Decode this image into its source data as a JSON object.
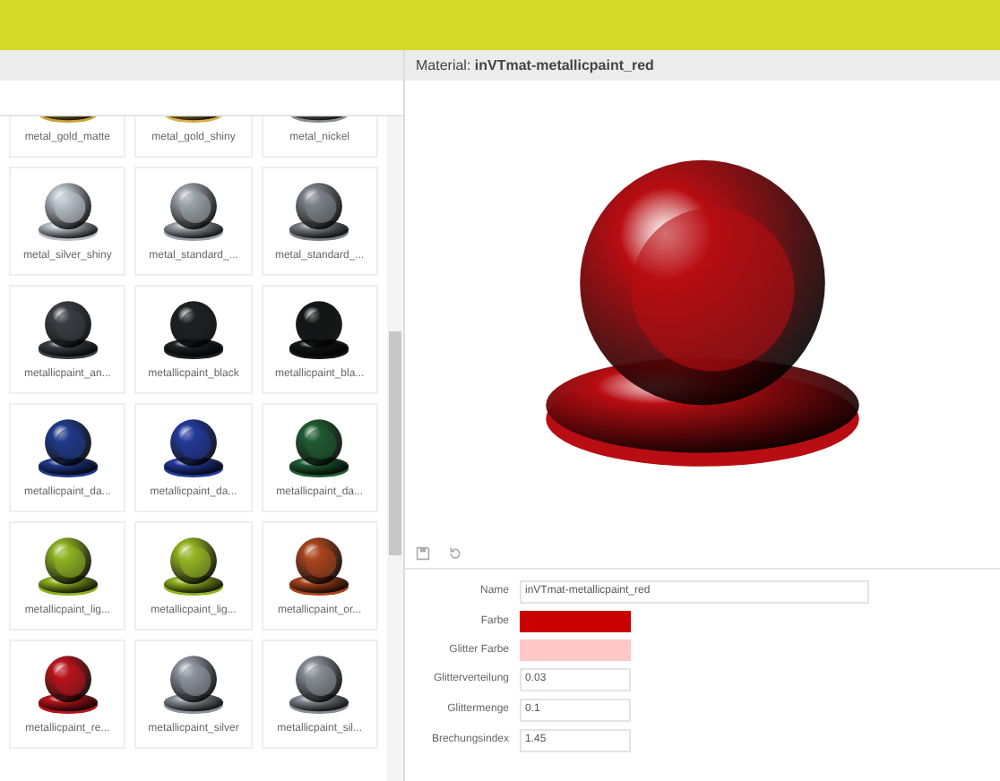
{
  "header": {
    "text": "Material: **inVTmat-metallicpaint_red**"
  },
  "materials": [
    {
      "label": "metal_gold_matte",
      "color": "#c9a23a"
    },
    {
      "label": "metal_gold_shiny",
      "color": "#d8b04a"
    },
    {
      "label": "metal_nickel",
      "color": "#8a8d92"
    },
    {
      "label": "metal_silver_shiny",
      "color": "#b8c0c8"
    },
    {
      "label": "metal_standard_...",
      "color": "#9aa0a8"
    },
    {
      "label": "metal_standard_...",
      "color": "#7c8088"
    },
    {
      "label": "metallicpaint_an...",
      "color": "#3a3d42"
    },
    {
      "label": "metallicpaint_black",
      "color": "#1e2022"
    },
    {
      "label": "metallicpaint_bla...",
      "color": "#141516"
    },
    {
      "label": "metallicpaint_da...",
      "color": "#1f3a8a"
    },
    {
      "label": "metallicpaint_da...",
      "color": "#22399a"
    },
    {
      "label": "metallicpaint_da...",
      "color": "#1f5a32"
    },
    {
      "label": "metallicpaint_lig...",
      "color": "#8db020"
    },
    {
      "label": "metallicpaint_lig...",
      "color": "#93b422"
    },
    {
      "label": "metallicpaint_or...",
      "color": "#a8441c"
    },
    {
      "label": "metallicpaint_re...",
      "color": "#b8141a"
    },
    {
      "label": "metallicpaint_silver",
      "color": "#8c939c"
    },
    {
      "label": "metallicpaint_sil...",
      "color": "#868c94"
    }
  ],
  "form": [
    {
      "kind": "text",
      "label": "Name",
      "value": "inVTmat-metallicpaint_red"
    },
    {
      "kind": "color",
      "label": "Farbe",
      "color": "#c80000"
    },
    {
      "kind": "color",
      "label": "Glitter Farbe",
      "color": "#ffc8c8"
    },
    {
      "kind": "number",
      "label": "Glitterverteilung",
      "value": "0.03"
    },
    {
      "kind": "number",
      "label": "Glittermenge",
      "value": "0.1"
    },
    {
      "kind": "number",
      "label": "Brechungsindex",
      "value": "1.45"
    }
  ]
}
